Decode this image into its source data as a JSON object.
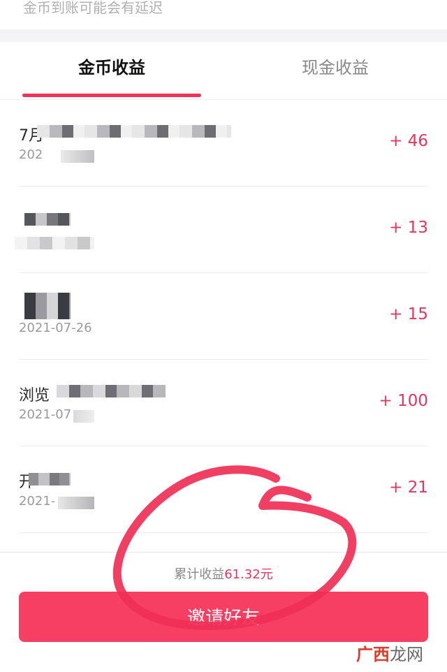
{
  "notice": {
    "text": "金币到账可能会有延迟"
  },
  "tabs": [
    {
      "label": "金币收益",
      "active": true
    },
    {
      "label": "现金收益",
      "active": false
    }
  ],
  "records": [
    {
      "title": "7月",
      "date": "202",
      "amount": "+ 46"
    },
    {
      "title": "",
      "date": "",
      "amount": "+ 13"
    },
    {
      "title": "",
      "date": "2021-07-26",
      "amount": "+ 15"
    },
    {
      "title": "浏览",
      "date": "2021-07",
      "amount": "+ 100"
    },
    {
      "title": "开",
      "date": "2021-",
      "amount": "+ 21"
    }
  ],
  "summary": {
    "label": "累计收益",
    "amount": "61.32元"
  },
  "invite_button": "邀请好友",
  "watermark": {
    "brand": "广西",
    "suffix": "龙网"
  },
  "colors": {
    "accent": "#f03255",
    "amount": "#e5355c",
    "button": "#f63f63"
  }
}
